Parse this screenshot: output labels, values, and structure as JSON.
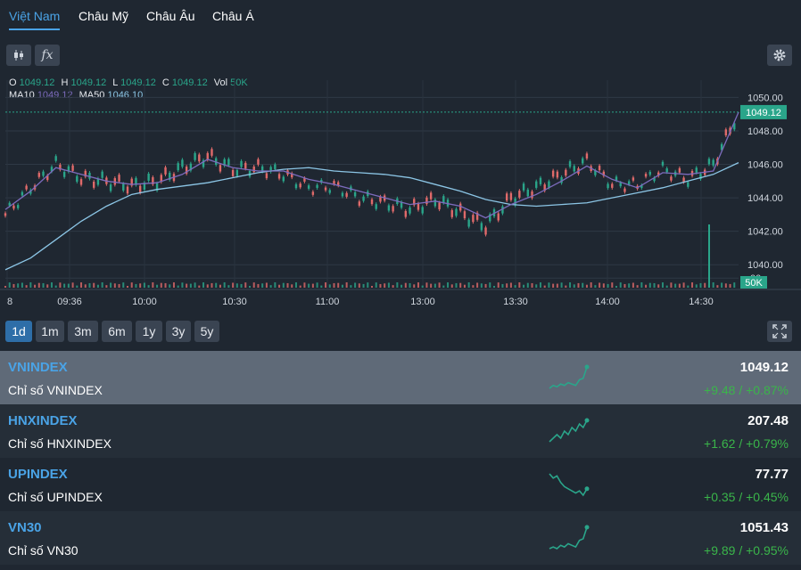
{
  "tabs": [
    "Việt Nam",
    "Châu Mỹ",
    "Châu Âu",
    "Châu Á"
  ],
  "toolbar": {
    "candles_icon": "candles-icon",
    "fx_label": "fx",
    "settings_icon": "gear-icon"
  },
  "ohlc": {
    "o_label": "O",
    "o": "1049.12",
    "h_label": "H",
    "h": "1049.12",
    "l_label": "L",
    "l": "1049.12",
    "c_label": "C",
    "c": "1049.12",
    "vol_label": "Vol",
    "vol": "50K",
    "ma10_label": "MA10",
    "ma10": "1049.12",
    "ma50_label": "MA50",
    "ma50": "1046.10"
  },
  "chart_data": {
    "type": "candlestick",
    "y_axis": {
      "min": 1039,
      "max": 1050.5,
      "ticks": [
        "1050.00",
        "1048.00",
        "1046.00",
        "1044.00",
        "1042.00",
        "1040.00",
        ".00"
      ]
    },
    "x_axis_ticks": [
      "8",
      "09:36",
      "10:00",
      "10:30",
      "11:00",
      "13:00",
      "13:30",
      "14:00",
      "14:30"
    ],
    "last_price_label": "1049.12",
    "volume_label": "50K",
    "colors": {
      "up": "#2aa58a",
      "down": "#e06a6a",
      "ma10": "#7c6bbd",
      "ma50": "#8cc6e6"
    },
    "ma50": [
      1039.7,
      1040.4,
      1041.5,
      1042.6,
      1043.5,
      1044.2,
      1044.5,
      1044.7,
      1044.9,
      1045.2,
      1045.5,
      1045.7,
      1045.8,
      1045.6,
      1045.5,
      1045.4,
      1045.2,
      1044.8,
      1044.4,
      1043.9,
      1043.6,
      1043.5,
      1043.6,
      1043.7,
      1044.0,
      1044.3,
      1044.6,
      1045.0,
      1045.4,
      1046.1
    ],
    "ma10": [
      1043.3,
      1044.4,
      1045.8,
      1045.4,
      1045.0,
      1044.8,
      1044.9,
      1045.4,
      1046.3,
      1045.8,
      1045.6,
      1045.6,
      1045.1,
      1044.8,
      1044.4,
      1044.0,
      1043.6,
      1043.8,
      1043.5,
      1042.8,
      1043.6,
      1044.2,
      1045.0,
      1045.9,
      1045.1,
      1044.6,
      1045.5,
      1045.4,
      1045.6,
      1049.12
    ],
    "price": [
      1043.0,
      1044.6,
      1046.0,
      1045.2,
      1045.0,
      1044.7,
      1045.0,
      1045.8,
      1046.5,
      1045.7,
      1045.8,
      1045.4,
      1044.6,
      1044.7,
      1044.0,
      1043.7,
      1043.3,
      1043.9,
      1043.1,
      1042.3,
      1044.0,
      1044.6,
      1045.4,
      1046.2,
      1044.8,
      1044.8,
      1045.7,
      1045.1,
      1046.0,
      1049.12
    ],
    "volume": [
      1,
      2,
      1,
      1,
      1,
      2,
      1,
      1,
      2,
      1,
      2,
      1,
      2,
      1,
      1,
      1,
      2,
      1,
      1,
      2,
      1,
      1,
      2,
      1,
      1,
      2,
      1,
      2,
      1,
      50
    ]
  },
  "ranges": [
    "1d",
    "1m",
    "3m",
    "6m",
    "1y",
    "3y",
    "5y"
  ],
  "indices": [
    {
      "symbol": "VNINDEX",
      "name": "Chỉ số VNINDEX",
      "price": "1049.12",
      "change": "+9.48 / +0.87%",
      "spark": [
        3,
        5,
        4,
        6,
        5,
        7,
        6,
        5,
        9,
        10,
        18
      ]
    },
    {
      "symbol": "HNXINDEX",
      "name": "Chỉ số HNXINDEX",
      "price": "207.48",
      "change": "+1.62 / +0.79%",
      "spark": [
        3,
        4,
        5,
        4,
        6,
        5,
        7,
        6,
        8,
        7,
        9
      ]
    },
    {
      "symbol": "UPINDEX",
      "name": "Chỉ số UPINDEX",
      "price": "77.77",
      "change": "+0.35 / +0.45%",
      "spark": [
        14,
        12,
        13,
        10,
        8,
        7,
        6,
        5,
        6,
        4,
        7
      ]
    },
    {
      "symbol": "VN30",
      "name": "Chỉ số VN30",
      "price": "1051.43",
      "change": "+9.89 / +0.95%",
      "spark": [
        4,
        5,
        4,
        6,
        5,
        7,
        6,
        5,
        9,
        10,
        17
      ]
    }
  ]
}
